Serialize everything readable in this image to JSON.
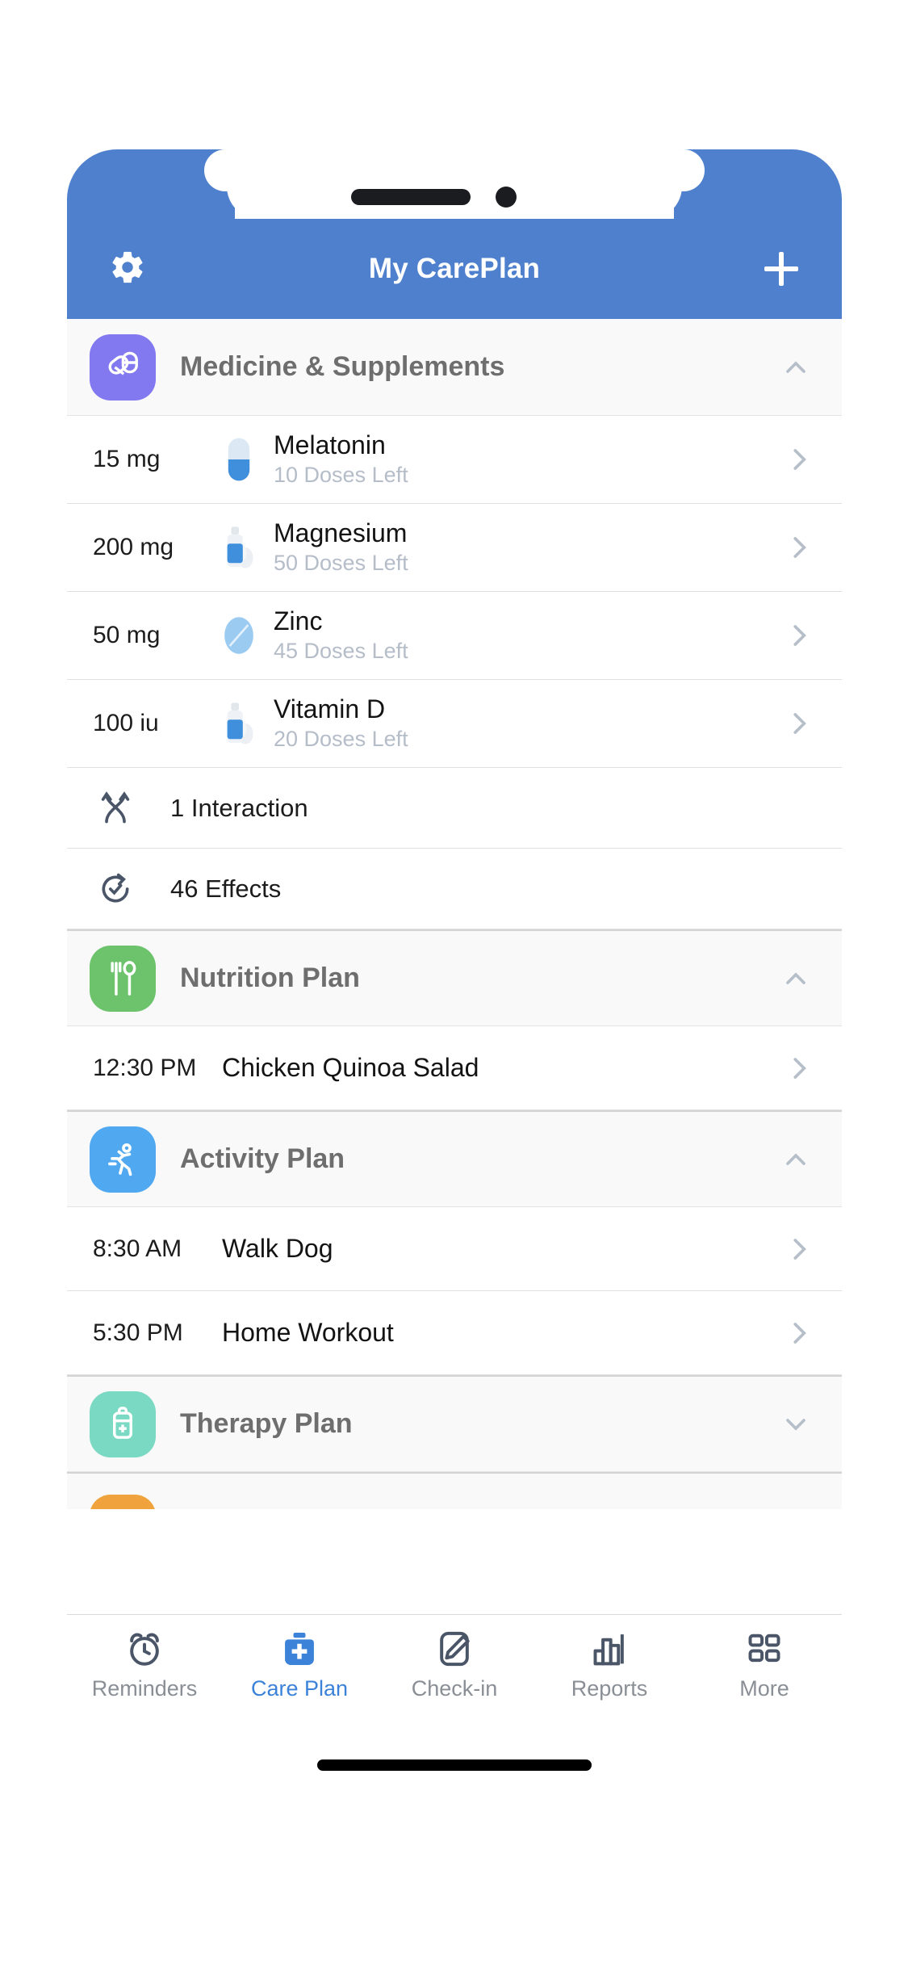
{
  "app": {
    "title": "My CarePlan",
    "header_bg": "#4f80ce",
    "settings_icon": "gear-icon",
    "add_icon": "plus-icon"
  },
  "sections": [
    {
      "id": "medicine",
      "title": "Medicine & Supplements",
      "icon": "pills-icon",
      "icon_color": "#8278f0",
      "expanded": true,
      "chevron": "chevron-up-icon",
      "medications": [
        {
          "dose": "15 mg",
          "name": "Melatonin",
          "sub": "10 Doses Left",
          "icon": "capsule-icon",
          "chevron": "chevron-right-icon"
        },
        {
          "dose": "200 mg",
          "name": "Magnesium",
          "sub": "50 Doses Left",
          "icon": "bottle-icon",
          "chevron": "chevron-right-icon"
        },
        {
          "dose": "50 mg",
          "name": "Zinc",
          "sub": "45 Doses Left",
          "icon": "tablet-icon",
          "chevron": "chevron-right-icon"
        },
        {
          "dose": "100 iu",
          "name": "Vitamin D",
          "sub": "20 Doses Left",
          "icon": "bottle-icon",
          "chevron": "chevron-right-icon"
        }
      ],
      "info_rows": [
        {
          "label": "1 Interaction",
          "icon": "interaction-icon"
        },
        {
          "label": "46 Effects",
          "icon": "effects-icon"
        }
      ]
    },
    {
      "id": "nutrition",
      "title": "Nutrition Plan",
      "icon": "fork-spoon-icon",
      "icon_color": "#6cc36c",
      "expanded": true,
      "chevron": "chevron-up-icon",
      "items": [
        {
          "time": "12:30 PM",
          "name": "Chicken Quinoa Salad",
          "chevron": "chevron-right-icon"
        }
      ]
    },
    {
      "id": "activity",
      "title": "Activity Plan",
      "icon": "runner-icon",
      "icon_color": "#4fa8f0",
      "expanded": true,
      "chevron": "chevron-up-icon",
      "items": [
        {
          "time": "8:30 AM",
          "name": "Walk Dog",
          "chevron": "chevron-right-icon"
        },
        {
          "time": "5:30 PM",
          "name": "Home Workout",
          "chevron": "chevron-right-icon"
        }
      ]
    },
    {
      "id": "therapy",
      "title": "Therapy Plan",
      "icon": "medkit-icon",
      "icon_color": "#7ad9c2",
      "expanded": false,
      "chevron": "chevron-down-icon",
      "items": []
    }
  ],
  "partial_section": {
    "icon": "rounded-orange-icon",
    "icon_color": "#f0a33c"
  },
  "tabbar": {
    "active": "Care Plan",
    "active_color": "#3b82d8",
    "inactive_color": "#8a8f96",
    "tabs": [
      {
        "label": "Reminders",
        "icon": "alarm-clock-icon",
        "active": false
      },
      {
        "label": "Care Plan",
        "icon": "medical-bag-icon",
        "active": true
      },
      {
        "label": "Check-in",
        "icon": "edit-pencil-icon",
        "active": false
      },
      {
        "label": "Reports",
        "icon": "bar-chart-icon",
        "active": false
      },
      {
        "label": "More",
        "icon": "grid-menu-icon",
        "active": false
      }
    ]
  }
}
